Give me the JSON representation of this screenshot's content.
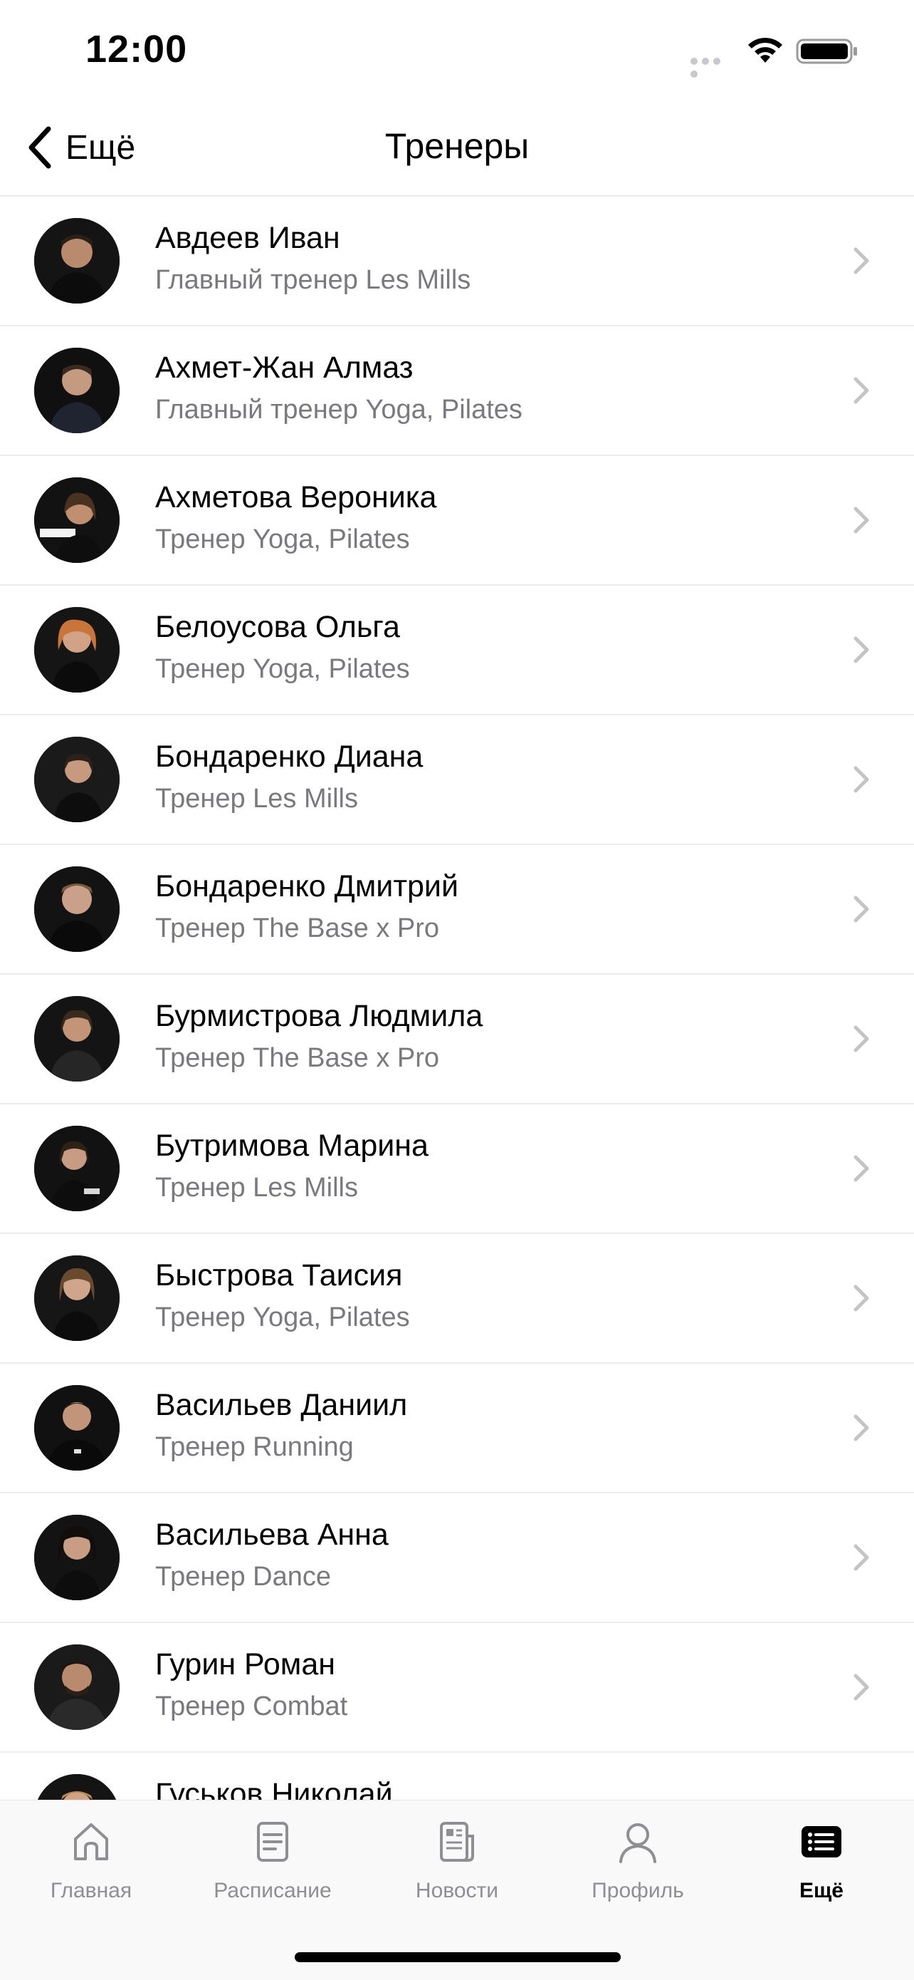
{
  "status_bar": {
    "time": "12:00"
  },
  "nav": {
    "back_label": "Ещё",
    "title": "Тренеры"
  },
  "trainers": [
    {
      "name": "Авдеев Иван",
      "role": "Главный тренер Les Mills"
    },
    {
      "name": "Ахмет-Жан Алмаз",
      "role": "Главный тренер Yoga, Pilates"
    },
    {
      "name": "Ахметова Вероника",
      "role": "Тренер Yoga, Pilates"
    },
    {
      "name": "Белоусова Ольга",
      "role": "Тренер Yoga, Pilates"
    },
    {
      "name": "Бондаренко Диана",
      "role": "Тренер Les Mills"
    },
    {
      "name": "Бондаренко Дмитрий",
      "role": "Тренер The Base x Pro"
    },
    {
      "name": "Бурмистрова Людмила",
      "role": "Тренер The Base x Pro"
    },
    {
      "name": "Бутримова Марина",
      "role": "Тренер Les Mills"
    },
    {
      "name": "Быстрова Таисия",
      "role": "Тренер Yoga, Pilates"
    },
    {
      "name": "Васильев Даниил",
      "role": "Тренер Running"
    },
    {
      "name": "Васильева Анна",
      "role": "Тренер Dance"
    },
    {
      "name": "Гурин Роман",
      "role": "Тренер Combat"
    },
    {
      "name": "Гуськов Николай",
      "role": ""
    }
  ],
  "tabs": [
    {
      "label": "Главная",
      "icon": "home-icon",
      "active": false
    },
    {
      "label": "Расписание",
      "icon": "schedule-icon",
      "active": false
    },
    {
      "label": "Новости",
      "icon": "news-icon",
      "active": false
    },
    {
      "label": "Профиль",
      "icon": "profile-icon",
      "active": false
    },
    {
      "label": "Ещё",
      "icon": "more-icon",
      "active": true
    }
  ],
  "colors": {
    "accent": "#000000",
    "secondary_text": "#7a7a7e",
    "inactive_tab": "#8e8e93",
    "separator": "#ececec"
  }
}
